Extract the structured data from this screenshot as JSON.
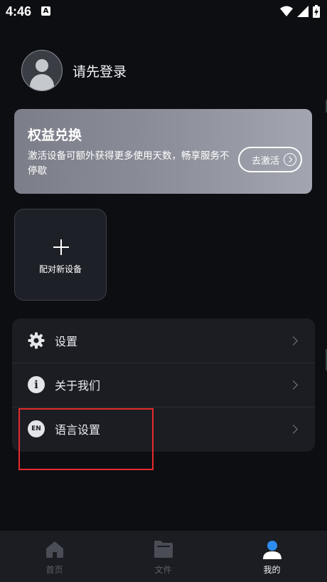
{
  "status_bar": {
    "time": "4:46",
    "notification_icon": "A"
  },
  "profile": {
    "login_prompt": "请先登录"
  },
  "rights_card": {
    "title": "权益兑换",
    "description": "激活设备可额外获得更多使用天数，畅享服务不停歇",
    "activate_label": "去激活"
  },
  "pair_card": {
    "label": "配对新设备"
  },
  "menu": {
    "items": [
      {
        "label": "设置",
        "icon": "gear-icon"
      },
      {
        "label": "关于我们",
        "icon": "info-icon"
      },
      {
        "label": "语言设置",
        "icon": "en-icon",
        "icon_text": "EN"
      }
    ]
  },
  "bottom_nav": {
    "items": [
      {
        "label": "首页",
        "icon": "home-icon",
        "active": false
      },
      {
        "label": "文件",
        "icon": "folder-icon",
        "active": false
      },
      {
        "label": "我的",
        "icon": "person-icon",
        "active": true
      }
    ]
  },
  "colors": {
    "background": "#0d0e12",
    "card": "#1b1d23",
    "accent_blue": "#2d8cf0",
    "highlight_red": "#e52b2b"
  }
}
